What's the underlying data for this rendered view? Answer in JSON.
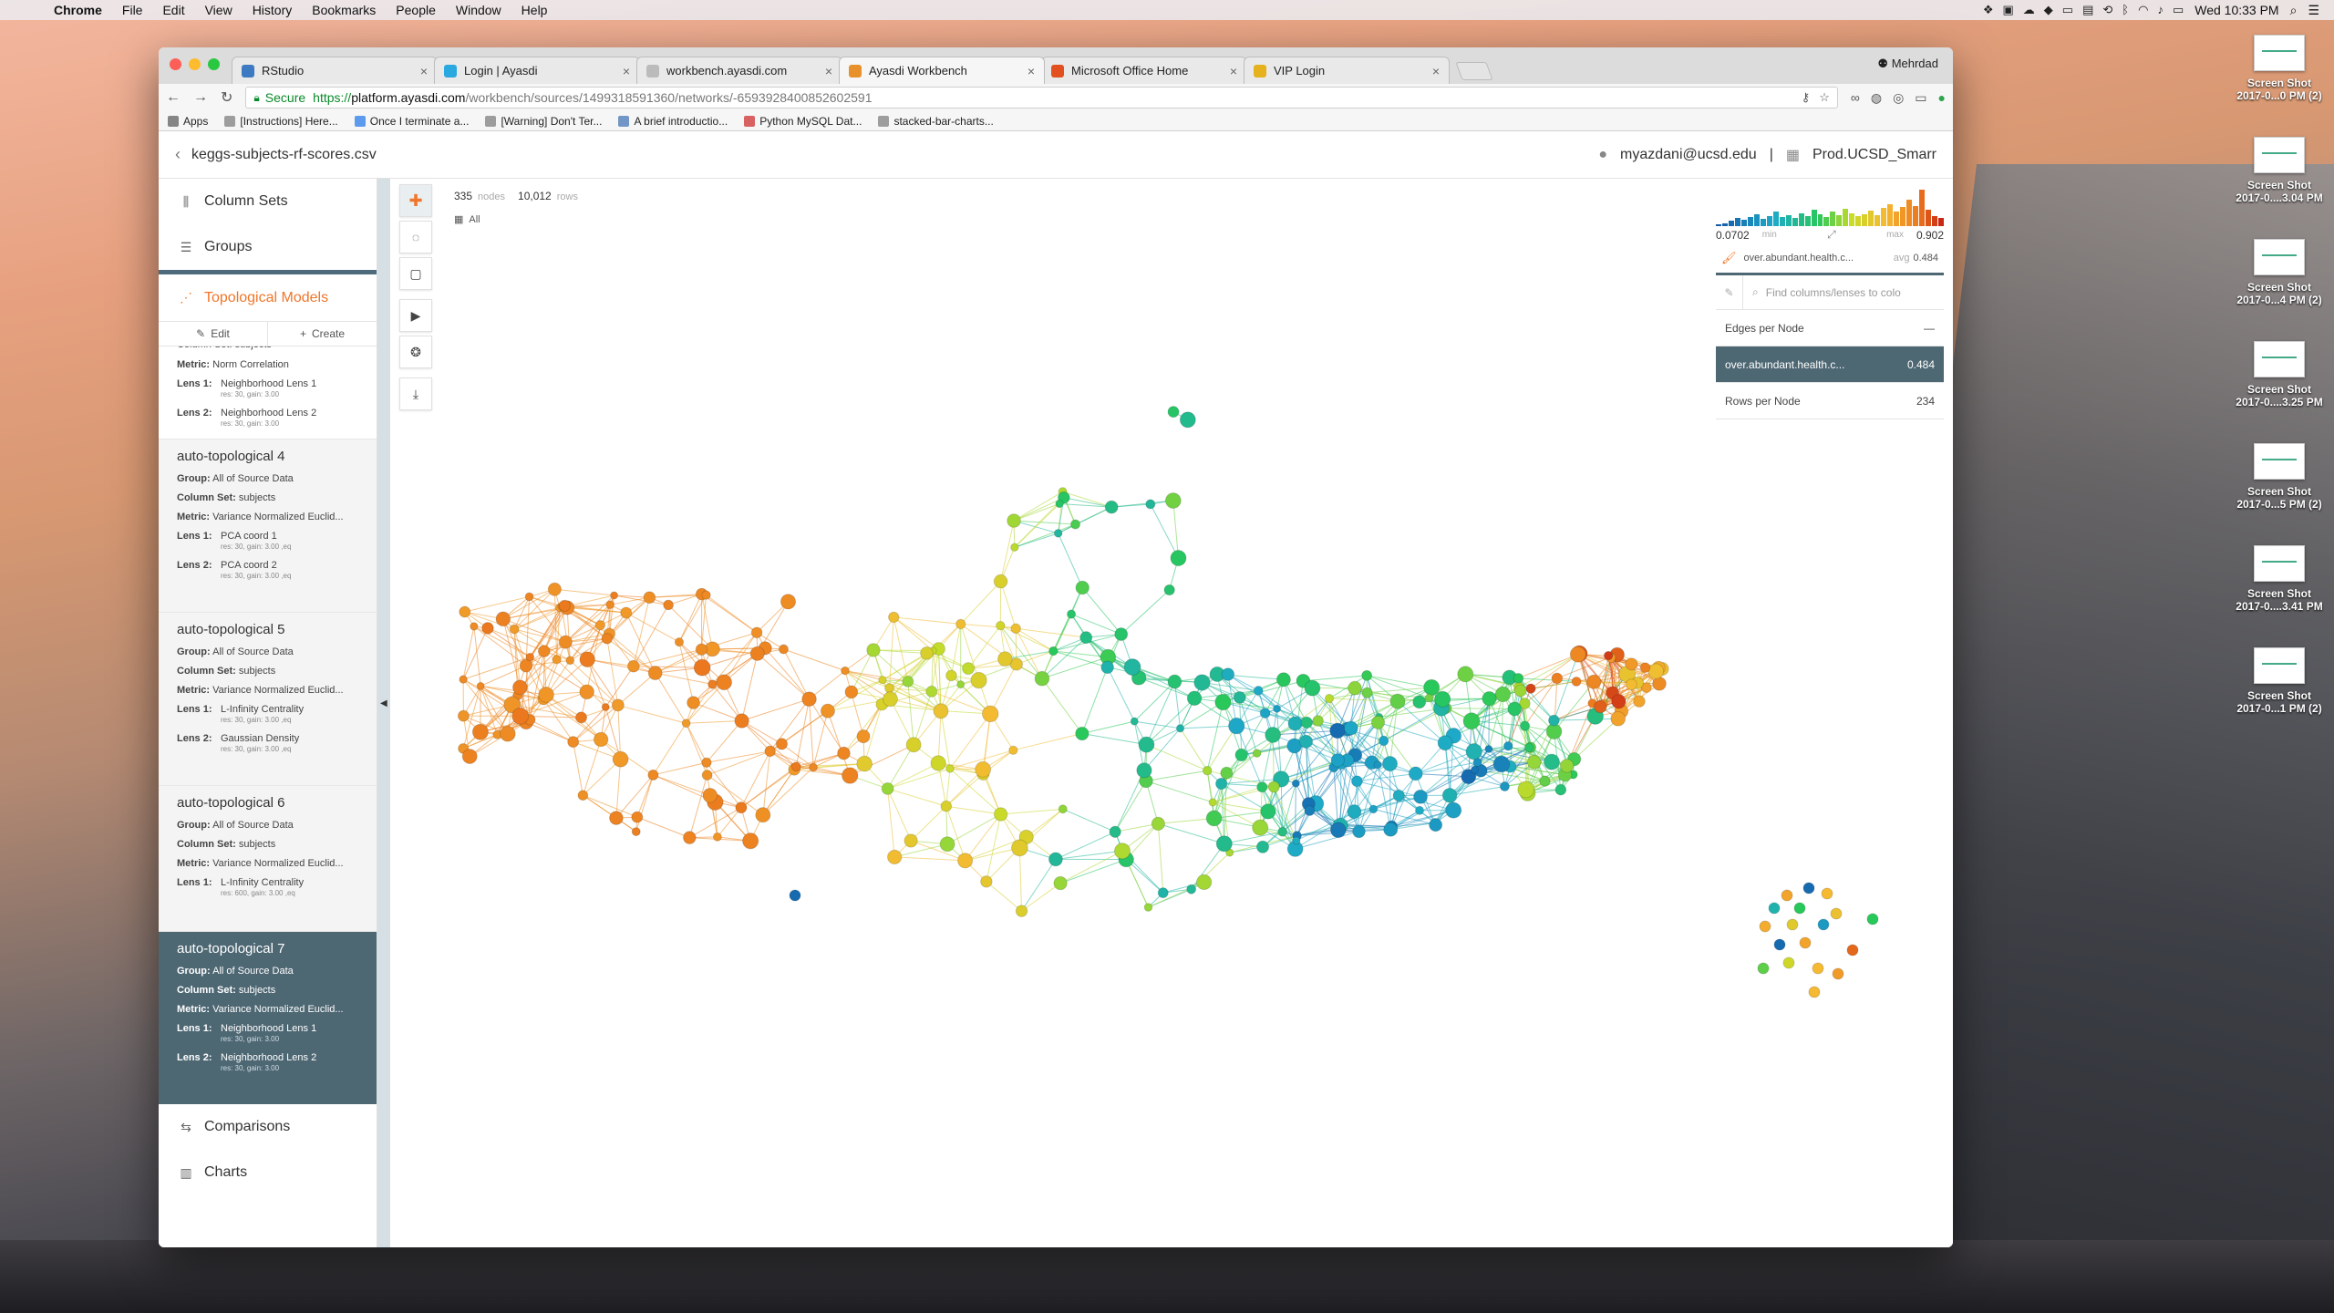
{
  "menubar": {
    "apple": "",
    "app": "Chrome",
    "items": [
      "File",
      "Edit",
      "View",
      "History",
      "Bookmarks",
      "People",
      "Window",
      "Help"
    ],
    "clock": "Wed 10:33 PM"
  },
  "desktop": {
    "icons": [
      {
        "line1": "Screen Shot",
        "line2": "2017-0...0 PM (2)"
      },
      {
        "line1": "Screen Shot",
        "line2": "2017-0....3.04 PM"
      },
      {
        "line1": "Screen Shot",
        "line2": "2017-0...4 PM (2)"
      },
      {
        "line1": "Screen Shot",
        "line2": "2017-0....3.25 PM"
      },
      {
        "line1": "Screen Shot",
        "line2": "2017-0...5 PM (2)"
      },
      {
        "line1": "Screen Shot",
        "line2": "2017-0....3.41 PM"
      },
      {
        "line1": "Screen Shot",
        "line2": "2017-0...1 PM (2)"
      }
    ]
  },
  "browser": {
    "tabs": [
      {
        "title": "RStudio",
        "color": "#3d7ac1"
      },
      {
        "title": "Login | Ayasdi",
        "color": "#2aa8e0"
      },
      {
        "title": "workbench.ayasdi.com",
        "color": "#bbbbbb"
      },
      {
        "title": "Ayasdi Workbench",
        "color": "#e8902a"
      },
      {
        "title": "Microsoft Office Home",
        "color": "#e2501f"
      },
      {
        "title": "VIP Login",
        "color": "#e5b21d"
      }
    ],
    "profile": "Mehrdad",
    "url": {
      "secure": "Secure",
      "scheme": "https://",
      "host": "platform.ayasdi.com",
      "path": "/workbench/sources/1499318591360/networks/-6593928400852602591"
    },
    "bookmarks": [
      "Apps",
      "[Instructions] Here...",
      "Once I terminate a...",
      "[Warning] Don't Ter...",
      "A brief introductio...",
      "Python MySQL Dat...",
      "stacked-bar-charts..."
    ]
  },
  "app": {
    "filename": "keggs-subjects-rf-scores.csv",
    "user": "myazdani@ucsd.edu",
    "separator": "|",
    "org": "Prod.UCSD_Smarr",
    "nav": {
      "column_sets": "Column Sets",
      "groups": "Groups",
      "topological_models": "Topological Models",
      "edit": "Edit",
      "create": "Create",
      "comparisons": "Comparisons",
      "charts": "Charts"
    },
    "models": [
      {
        "title": "",
        "partial_top": "Column Set: subjects",
        "metric": "Norm Correlation",
        "lenses": [
          {
            "label": "Lens 1:",
            "name": "Neighborhood Lens 1",
            "params": "res: 30, gain: 3.00"
          },
          {
            "label": "Lens 2:",
            "name": "Neighborhood Lens 2",
            "params": "res: 30, gain: 3.00"
          }
        ]
      },
      {
        "title": "auto-topological 4",
        "group": "All of Source Data",
        "column_set": "subjects",
        "metric": "Variance Normalized Euclid...",
        "lenses": [
          {
            "label": "Lens 1:",
            "name": "PCA coord 1",
            "params": "res: 30, gain: 3.00 ,eq"
          },
          {
            "label": "Lens 2:",
            "name": "PCA coord 2",
            "params": "res: 30, gain: 3.00 ,eq"
          }
        ]
      },
      {
        "title": "auto-topological 5",
        "group": "All of Source Data",
        "column_set": "subjects",
        "metric": "Variance Normalized Euclid...",
        "lenses": [
          {
            "label": "Lens 1:",
            "name": "L-Infinity Centrality",
            "params": "res: 30, gain: 3.00 ,eq"
          },
          {
            "label": "Lens 2:",
            "name": "Gaussian Density",
            "params": "res: 30, gain: 3.00 ,eq"
          }
        ]
      },
      {
        "title": "auto-topological 6",
        "group": "All of Source Data",
        "column_set": "subjects",
        "metric": "Variance Normalized Euclid...",
        "lenses": [
          {
            "label": "Lens 1:",
            "name": "L-Infinity Centrality",
            "params": "res: 600, gain: 3.00 ,eq"
          }
        ]
      },
      {
        "title": "auto-topological 7",
        "group": "All of Source Data",
        "column_set": "subjects",
        "metric": "Variance Normalized Euclid...",
        "lenses": [
          {
            "label": "Lens 1:",
            "name": "Neighborhood Lens 1",
            "params": "res: 30, gain: 3.00"
          },
          {
            "label": "Lens 2:",
            "name": "Neighborhood Lens 2",
            "params": "res: 30, gain: 3.00"
          }
        ]
      }
    ],
    "labels": {
      "group": "Group:",
      "column_set": "Column Set:",
      "metric": "Metric:"
    },
    "canvas": {
      "nodes_count": "335",
      "nodes_label": "nodes",
      "rows_count": "10,012",
      "rows_label": "rows",
      "selection": "All"
    },
    "color_panel": {
      "min_value": "0.0702",
      "min_label": "min",
      "max_label": "max",
      "max_value": "0.902",
      "attribute": "over.abundant.health.c...",
      "avg_label": "avg",
      "avg_value": "0.484",
      "search_placeholder": "Find columns/lenses to colo",
      "rows": [
        {
          "label": "Edges per Node",
          "value": "—"
        },
        {
          "label": "over.abundant.health.c...",
          "value": "0.484"
        },
        {
          "label": "Rows per Node",
          "value": "234"
        }
      ]
    },
    "colors": {
      "accent": "#f0762a",
      "selected": "#4d6773"
    }
  }
}
